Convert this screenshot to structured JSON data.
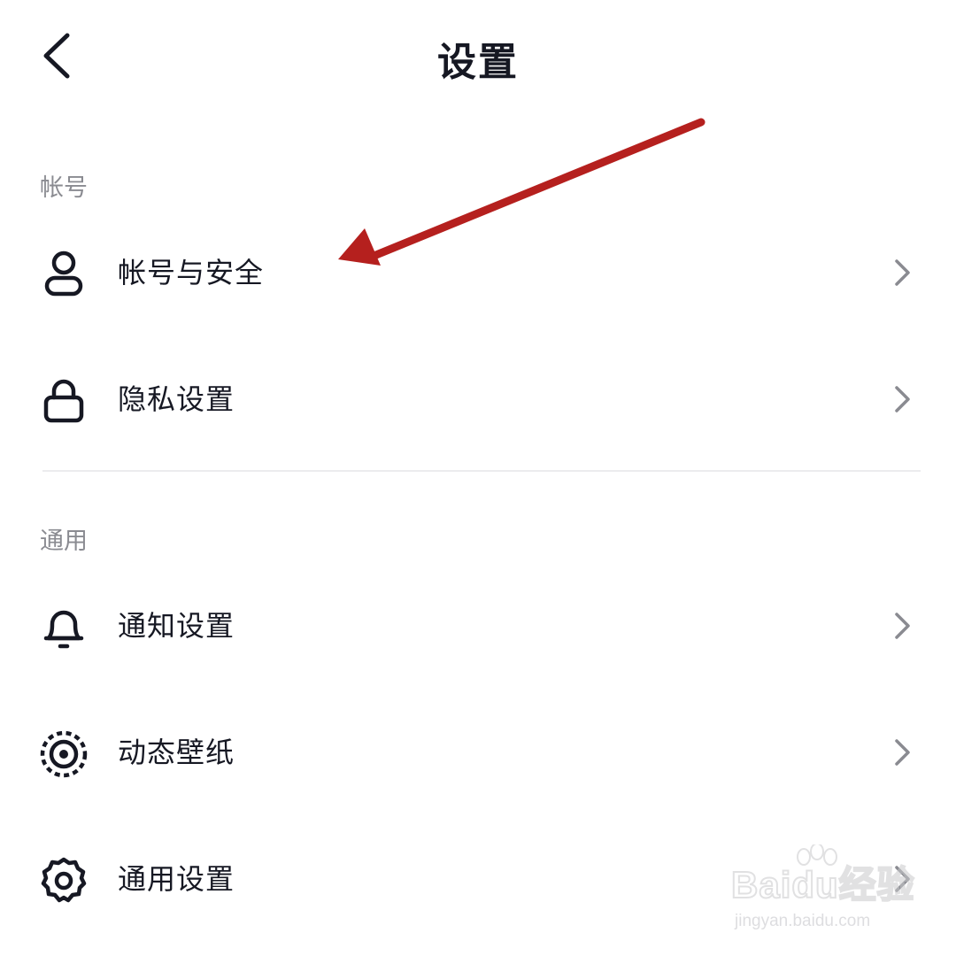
{
  "header": {
    "title": "设置",
    "back_icon": "chevron-left-icon"
  },
  "sections": [
    {
      "header": "帐号",
      "items": [
        {
          "label": "帐号与安全",
          "icon": "user-icon"
        },
        {
          "label": "隐私设置",
          "icon": "lock-icon"
        }
      ]
    },
    {
      "header": "通用",
      "items": [
        {
          "label": "通知设置",
          "icon": "bell-icon"
        },
        {
          "label": "动态壁纸",
          "icon": "live-wallpaper-icon"
        },
        {
          "label": "通用设置",
          "icon": "gear-icon"
        }
      ]
    }
  ],
  "annotation": {
    "arrow_color": "#b5201e",
    "points_to": "帐号与安全"
  },
  "watermark": {
    "brand": "Baidu经验",
    "url": "jingyan.baidu.com"
  },
  "colors": {
    "text_primary": "#161823",
    "text_secondary": "#8a8b91",
    "chevron": "#8a8b91",
    "divider": "#ececee"
  }
}
